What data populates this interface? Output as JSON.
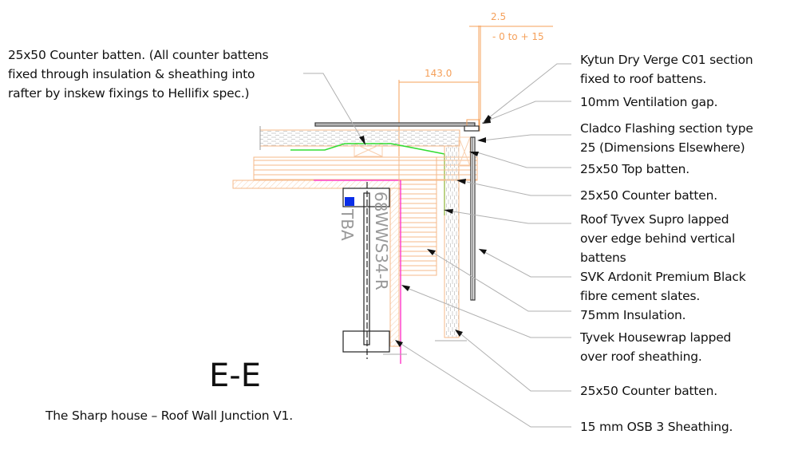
{
  "drawing": {
    "section_title": "E-E",
    "caption": "The Sharp house – Roof Wall Junction V1.",
    "colors": {
      "timber": "#f5b98a",
      "membrane_green": "#33dd33",
      "membrane_magenta": "#ff44cc",
      "flashing": "#333333",
      "leader": "#b0b0b0",
      "dimension": "#f5a05a",
      "marker_blue": "#0a2ee8"
    },
    "dimensions": {
      "top": "2.5",
      "tolerance": "- 0  to + 15",
      "width": "143.0"
    },
    "tags": {
      "window_ref": "WWS34-R",
      "window_size": "68",
      "window_note": "TBA"
    }
  },
  "left_note": {
    "lines": [
      "25x50 Counter batten. (All counter battens",
      "fixed through insulation & sheathing into",
      "rafter by inskew fixings to Hellifix spec.)"
    ]
  },
  "labels": [
    {
      "lines": [
        "Kytun Dry Verge C01 section",
        "fixed to roof battens."
      ]
    },
    {
      "lines": [
        "10mm Ventilation gap."
      ]
    },
    {
      "lines": [
        "Cladco Flashing section type",
        "25 (Dimensions Elsewhere)"
      ]
    },
    {
      "lines": [
        "25x50 Top batten."
      ]
    },
    {
      "lines": [
        "25x50 Counter batten."
      ]
    },
    {
      "lines": [
        "Roof Tyvex Supro lapped",
        "over edge behind vertical",
        "battens"
      ]
    },
    {
      "lines": [
        "SVK Ardonit Premium Black",
        "fibre cement slates."
      ]
    },
    {
      "lines": [
        "75mm Insulation."
      ]
    },
    {
      "lines": [
        "Tyvek Housewrap lapped",
        "over roof sheathing."
      ]
    },
    {
      "lines": [
        "25x50 Counter batten."
      ]
    },
    {
      "lines": [
        "15 mm OSB 3 Sheathing."
      ]
    }
  ]
}
